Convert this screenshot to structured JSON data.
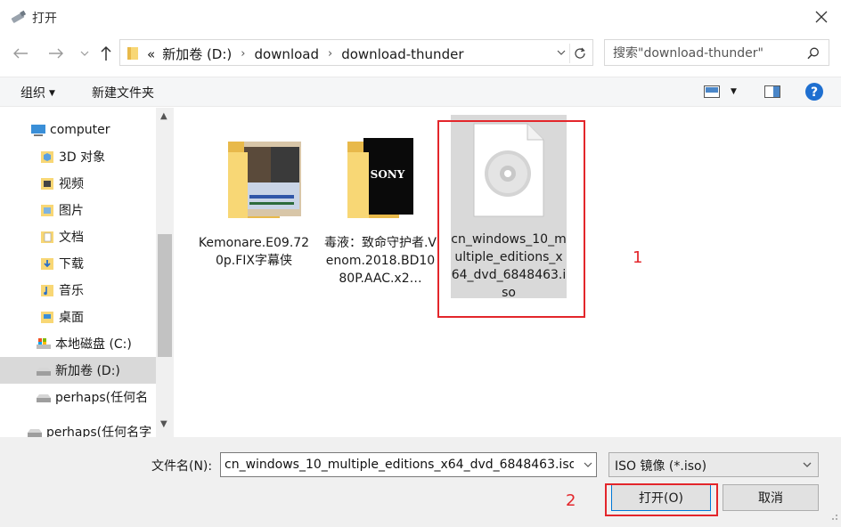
{
  "window": {
    "title": "打开",
    "close_label": "×"
  },
  "address": {
    "prefix": "«",
    "crumbs": [
      "新加卷 (D:)",
      "download",
      "download-thunder"
    ]
  },
  "search": {
    "placeholder": "搜索\"download-thunder\""
  },
  "toolbar": {
    "organize_label": "组织",
    "newfolder_label": "新建文件夹"
  },
  "sidebar": {
    "items": [
      {
        "label": "computer",
        "icon": "computer-icon"
      },
      {
        "label": "3D 对象",
        "icon": "3d-objects-icon"
      },
      {
        "label": "视频",
        "icon": "video-folder-icon"
      },
      {
        "label": "图片",
        "icon": "pictures-folder-icon"
      },
      {
        "label": "文档",
        "icon": "documents-folder-icon"
      },
      {
        "label": "下载",
        "icon": "downloads-folder-icon"
      },
      {
        "label": "音乐",
        "icon": "music-folder-icon"
      },
      {
        "label": "桌面",
        "icon": "desktop-folder-icon"
      },
      {
        "label": "本地磁盘 (C:)",
        "icon": "system-drive-icon"
      },
      {
        "label": "新加卷 (D:)",
        "icon": "drive-icon"
      },
      {
        "label": "perhaps(任何名",
        "icon": "drive-icon"
      },
      {
        "label": "perhaps(任何名字",
        "icon": "drive-icon"
      }
    ]
  },
  "files": [
    {
      "name": "Kemonare.E09.720p.FIX字幕侠",
      "type": "folder",
      "thumb_text": ""
    },
    {
      "name": "毒液：致命守护者.Venom.2018.BD1080P.AAC.x2…",
      "type": "folder",
      "thumb_text": "SONY"
    },
    {
      "name": "cn_windows_10_multiple_editions_x64_dvd_6848463.iso",
      "type": "iso",
      "thumb_text": ""
    }
  ],
  "annotations": {
    "marker1": "1",
    "marker2": "2"
  },
  "bottom": {
    "filename_label": "文件名(N):",
    "filename_value": "cn_windows_10_multiple_editions_x64_dvd_6848463.iso",
    "filetype_value": "ISO 镜像 (*.iso)",
    "open_label": "打开(O)",
    "cancel_label": "取消"
  },
  "colors": {
    "accent": "#0078d7",
    "annotation": "#e3262b",
    "selection": "#d9d9d9",
    "folder": "#f8d775"
  }
}
